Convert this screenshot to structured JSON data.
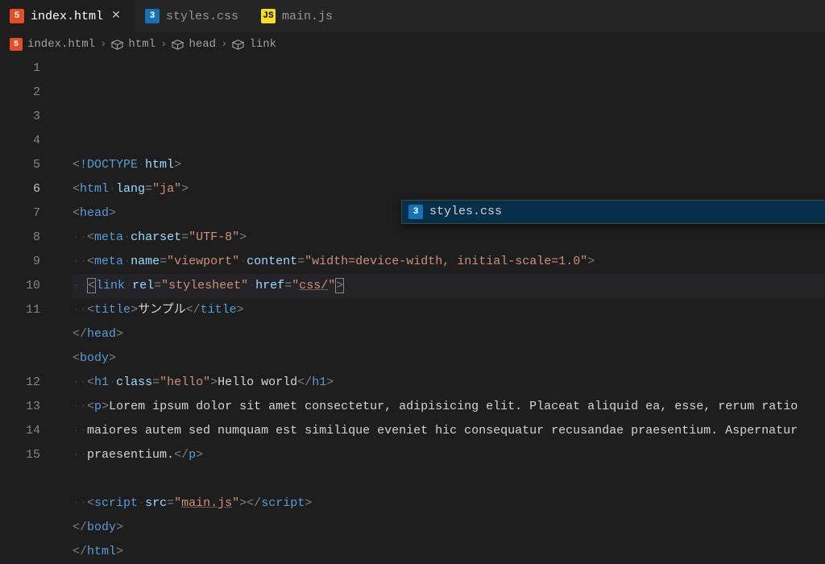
{
  "tabs": [
    {
      "label": "index.html",
      "type": "html5",
      "iconGlyph": "5",
      "active": true
    },
    {
      "label": "styles.css",
      "type": "css3",
      "iconGlyph": "3",
      "active": false
    },
    {
      "label": "main.js",
      "type": "js",
      "iconGlyph": "JS",
      "active": false
    }
  ],
  "breadcrumb": {
    "file": "index.html",
    "parts": [
      "html",
      "head",
      "link"
    ]
  },
  "suggestion": {
    "label": "styles.css"
  },
  "code": {
    "activeLine": 6,
    "lines": [
      {
        "n": 1,
        "indent": 0,
        "kind": "doctype"
      },
      {
        "n": 2,
        "indent": 0,
        "kind": "html-open"
      },
      {
        "n": 3,
        "indent": 0,
        "kind": "head-open"
      },
      {
        "n": 4,
        "indent": 1,
        "kind": "meta-charset"
      },
      {
        "n": 5,
        "indent": 1,
        "kind": "meta-viewport"
      },
      {
        "n": 6,
        "indent": 1,
        "kind": "link",
        "cursorLine": true
      },
      {
        "n": 7,
        "indent": 1,
        "kind": "title"
      },
      {
        "n": 8,
        "indent": 0,
        "kind": "head-close"
      },
      {
        "n": 9,
        "indent": 0,
        "kind": "body-open"
      },
      {
        "n": 10,
        "indent": 1,
        "kind": "h1"
      },
      {
        "n": 11,
        "indent": 1,
        "kind": "p1"
      },
      {
        "n": 11,
        "indent": 1,
        "kind": "p2",
        "hideNum": true
      },
      {
        "n": 11,
        "indent": 1,
        "kind": "p3",
        "hideNum": true
      },
      {
        "n": 12,
        "indent": 0,
        "kind": "blank"
      },
      {
        "n": 13,
        "indent": 1,
        "kind": "script"
      },
      {
        "n": 14,
        "indent": 0,
        "kind": "body-close"
      },
      {
        "n": 15,
        "indent": 0,
        "kind": "html-close"
      }
    ]
  },
  "tokens": {
    "doctype": "!DOCTYPE",
    "html": "html",
    "lang": "lang",
    "ja": "ja",
    "head": "head",
    "meta": "meta",
    "charset": "charset",
    "utf8": "UTF-8",
    "name": "name",
    "viewport": "viewport",
    "content": "content",
    "viewportContent": "width=device-width, initial-scale=1.0",
    "link": "link",
    "rel": "rel",
    "stylesheet": "stylesheet",
    "href": "href",
    "cssPath": "css/",
    "title": "title",
    "titleText": "サンプル",
    "body": "body",
    "h1": "h1",
    "class": "class",
    "hello": "hello",
    "helloText": "Hello world",
    "p": "p",
    "para1": "Lorem ipsum dolor sit amet consectetur, adipisicing elit. Placeat aliquid ea, esse, rerum ratio",
    "para2": "maiores autem sed numquam est similique eveniet hic consequatur recusandae praesentium. Aspernatur",
    "para3": "praesentium.",
    "scriptTag": "script",
    "src": "src",
    "mainjs": "main.js"
  }
}
